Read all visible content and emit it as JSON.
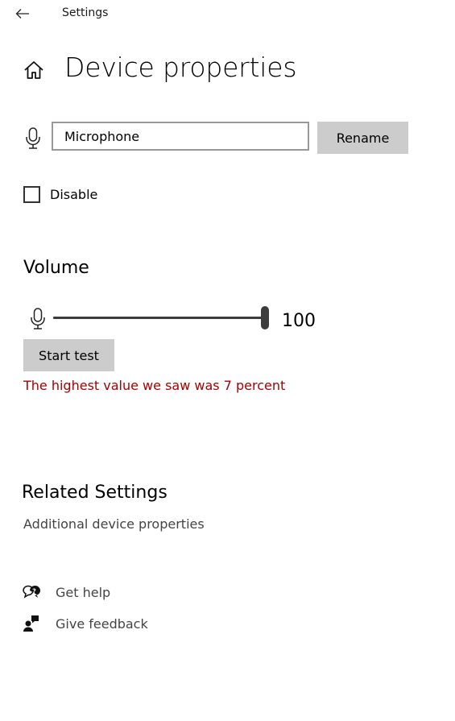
{
  "app": {
    "title": "Settings"
  },
  "header": {
    "title": "Device properties"
  },
  "device": {
    "name_value": "Microphone",
    "rename_label": "Rename",
    "disable_label": "Disable",
    "disabled": false
  },
  "volume": {
    "section_title": "Volume",
    "value": 100,
    "value_text": "100",
    "start_test_label": "Start test",
    "test_result": "The highest value we saw was 7 percent"
  },
  "related": {
    "section_title": "Related Settings",
    "link_label": "Additional device properties"
  },
  "help": {
    "items": [
      {
        "label": "Get help",
        "icon": "get-help-icon"
      },
      {
        "label": "Give feedback",
        "icon": "give-feedback-icon"
      }
    ]
  },
  "colors": {
    "button_bg": "#cccccc",
    "error_text": "#a80000",
    "slider": "#3c3c3c"
  }
}
